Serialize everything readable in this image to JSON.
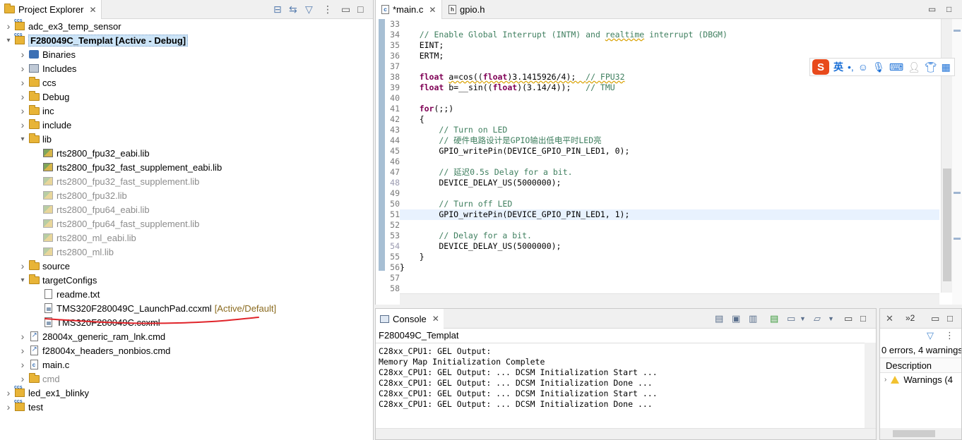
{
  "project_explorer": {
    "tab_label": "Project Explorer",
    "tree": [
      {
        "label": "adc_ex3_temp_sensor",
        "depth": 0,
        "icon": "project-icon",
        "expanded": false
      },
      {
        "label": "F280049C_Templat  [Active - Debug]",
        "depth": 0,
        "icon": "project-icon",
        "expanded": true,
        "selected": true
      },
      {
        "label": "Binaries",
        "depth": 1,
        "icon": "binaries-icon",
        "expanded": false
      },
      {
        "label": "Includes",
        "depth": 1,
        "icon": "includes-icon",
        "expanded": false
      },
      {
        "label": "ccs",
        "depth": 1,
        "icon": "folder-icon",
        "expanded": false
      },
      {
        "label": "Debug",
        "depth": 1,
        "icon": "folder-icon",
        "expanded": false
      },
      {
        "label": "inc",
        "depth": 1,
        "icon": "folder-icon",
        "expanded": false
      },
      {
        "label": "include",
        "depth": 1,
        "icon": "folder-icon",
        "expanded": false
      },
      {
        "label": "lib",
        "depth": 1,
        "icon": "folder-icon",
        "expanded": true
      },
      {
        "label": "rts2800_fpu32_eabi.lib",
        "depth": 2,
        "icon": "library-icon"
      },
      {
        "label": "rts2800_fpu32_fast_supplement_eabi.lib",
        "depth": 2,
        "icon": "library-icon"
      },
      {
        "label": "rts2800_fpu32_fast_supplement.lib",
        "depth": 2,
        "icon": "library-icon",
        "dim": true
      },
      {
        "label": "rts2800_fpu32.lib",
        "depth": 2,
        "icon": "library-icon",
        "dim": true
      },
      {
        "label": "rts2800_fpu64_eabi.lib",
        "depth": 2,
        "icon": "library-icon",
        "dim": true
      },
      {
        "label": "rts2800_fpu64_fast_supplement.lib",
        "depth": 2,
        "icon": "library-icon",
        "dim": true
      },
      {
        "label": "rts2800_ml_eabi.lib",
        "depth": 2,
        "icon": "library-icon",
        "dim": true
      },
      {
        "label": "rts2800_ml.lib",
        "depth": 2,
        "icon": "library-icon",
        "dim": true
      },
      {
        "label": "source",
        "depth": 1,
        "icon": "folder-icon",
        "expanded": false
      },
      {
        "label": "targetConfigs",
        "depth": 1,
        "icon": "folder-icon",
        "expanded": true
      },
      {
        "label": "readme.txt",
        "depth": 2,
        "icon": "text-file-icon"
      },
      {
        "label": "TMS320F280049C_LaunchPad.ccxml",
        "depth": 2,
        "icon": "target-config-icon",
        "decoration": "[Active/Default]"
      },
      {
        "label": "TMS320F280049C.ccxml",
        "depth": 2,
        "icon": "target-config-icon"
      },
      {
        "label": "28004x_generic_ram_lnk.cmd",
        "depth": 1,
        "icon": "linked-file-icon",
        "expanded": false
      },
      {
        "label": "f28004x_headers_nonbios.cmd",
        "depth": 1,
        "icon": "linked-file-icon",
        "expanded": false
      },
      {
        "label": "main.c",
        "depth": 1,
        "icon": "c-file-icon",
        "expanded": false
      },
      {
        "label": "cmd",
        "depth": 1,
        "icon": "folder-icon",
        "expanded": false,
        "dim": true
      },
      {
        "label": "led_ex1_blinky",
        "depth": 0,
        "icon": "project-icon",
        "expanded": false
      },
      {
        "label": "test",
        "depth": 0,
        "icon": "project-icon",
        "expanded": false
      }
    ]
  },
  "editor": {
    "tabs": [
      {
        "label": "*main.c",
        "active": true
      },
      {
        "label": "gpio.h",
        "active": false
      }
    ],
    "current_line": 51,
    "lines": [
      {
        "n": "33",
        "html": ""
      },
      {
        "n": "34",
        "html": "    <span class='cm'>// Enable Global Interrupt (INTM) and <span class='sq'>realtime</span> interrupt (DBGM)</span>"
      },
      {
        "n": "35",
        "html": "    EINT;"
      },
      {
        "n": "36",
        "html": "    ERTM;"
      },
      {
        "n": "37",
        "html": ""
      },
      {
        "n": "38",
        "html": "    <span class='kw'>float</span> <span class='sq'>a=cos((<span class='kw'>float</span>)3.1415926/4);  <span class='cm'>// FPU32</span></span>"
      },
      {
        "n": "39",
        "html": "    <span class='kw'>float</span> b=__sin((<span class='kw'>float</span>)(3.14/4));   <span class='cm'>// TMU</span>"
      },
      {
        "n": "40",
        "html": ""
      },
      {
        "n": "41",
        "html": "    <span class='kw'>for</span>(;;)"
      },
      {
        "n": "42",
        "html": "    {"
      },
      {
        "n": "43",
        "html": "        <span class='cm'>// Turn on LED</span>"
      },
      {
        "n": "44",
        "html": "        <span class='cm'>// 硬件电路设计是GPIO输出低电平时LED亮</span>"
      },
      {
        "n": "45",
        "html": "        GPIO_writePin(DEVICE_GPIO_PIN_LED1, 0);"
      },
      {
        "n": "46",
        "html": ""
      },
      {
        "n": "47",
        "html": "        <span class='cm'>// 延迟0.5s Delay for a bit.</span>"
      },
      {
        "n": "48",
        "html": "        DEVICE_DELAY_US(5000000);"
      },
      {
        "n": "49",
        "html": ""
      },
      {
        "n": "50",
        "html": "        <span class='cm'>// Turn off LED</span>"
      },
      {
        "n": "51",
        "html": "        GPIO_writePin(DEVICE_GPIO_PIN_LED1, 1);"
      },
      {
        "n": "52",
        "html": ""
      },
      {
        "n": "53",
        "html": "        <span class='cm'>// Delay for a bit.</span>"
      },
      {
        "n": "54",
        "html": "        DEVICE_DELAY_US(5000000);"
      },
      {
        "n": "55",
        "html": "    }"
      },
      {
        "n": "56",
        "html": "}"
      },
      {
        "n": "57",
        "html": ""
      },
      {
        "n": "58",
        "html": ""
      }
    ]
  },
  "ime_toolbar": {
    "logo": "S",
    "mode": "英",
    "icons": [
      "punctuation-icon",
      "emoji-icon",
      "microphone-icon",
      "keyboard-icon",
      "user-icon",
      "skin-icon",
      "grid-icon"
    ]
  },
  "console": {
    "tab_label": "Console",
    "title": "F280049C_Templat",
    "lines": [
      "C28xx_CPU1: GEL Output:",
      "Memory Map Initialization Complete",
      "C28xx_CPU1: GEL Output: ... DCSM Initialization Start ...",
      "C28xx_CPU1: GEL Output: ... DCSM Initialization Done ...",
      "C28xx_CPU1: GEL Output: ... DCSM Initialization Start ...",
      "C28xx_CPU1: GEL Output: ... DCSM Initialization Done ..."
    ]
  },
  "problems": {
    "tab_overflow_label": "»2",
    "summary": "0 errors, 4 warnings",
    "column_header": "Description",
    "row_label": "Warnings (4"
  },
  "colors": {
    "selection": "#cce4f7",
    "comment": "#3f7f5f",
    "keyword": "#7f0055",
    "current_line": "#e8f2fe",
    "annotation_red": "#e0242a"
  }
}
